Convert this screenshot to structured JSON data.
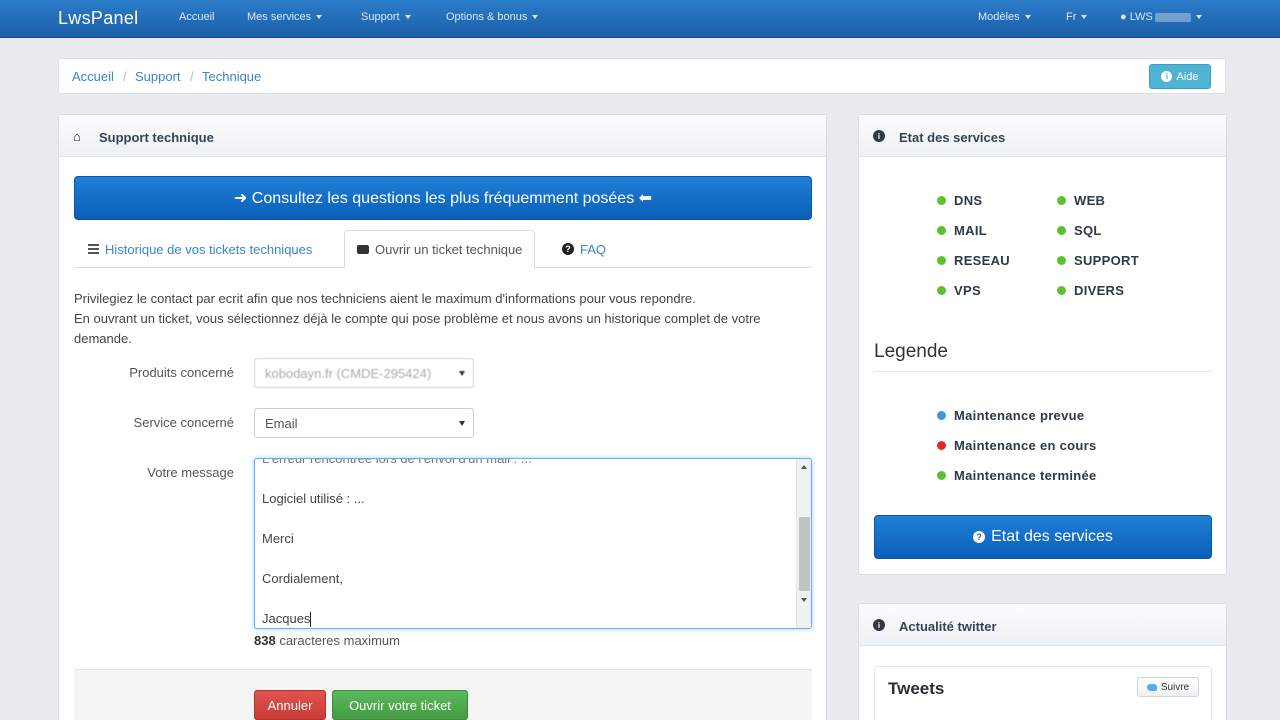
{
  "navbar": {
    "brand": "LwsPanel",
    "items": [
      "Accueil",
      "Mes services",
      "Support",
      "Options & bonus"
    ],
    "right": {
      "models": "Modèles",
      "lang": "Fr",
      "user": "LWS"
    }
  },
  "breadcrumb": {
    "items": [
      "Accueil",
      "Support",
      "Technique"
    ],
    "help_label": "Aide"
  },
  "support_panel": {
    "title": "Support technique",
    "faq_button": "➜ Consultez les questions les plus fréquemment posées ⬅",
    "tabs": [
      "Historique de vos tickets techniques",
      "Ouvrir un ticket technique",
      "FAQ"
    ],
    "intro_line1": "Privilegiez le contact par ecrit afin que nos techniciens aient le maximum d'informations pour vous repondre.",
    "intro_line2": "En ouvrant un ticket, vous sélectionnez déjà le compte qui pose problème et nous avons un historique complet de votre demande.",
    "fields": {
      "product_label": "Produits concerné",
      "product_value": "kobodayn.fr (CMDE-295424)",
      "service_label": "Service concerné",
      "service_value": "Email",
      "message_label": "Votre message"
    },
    "message_lines": {
      "cut": "L'erreur rencontrée lors de l'envoi d'un mail : ...",
      "l1": "Logiciel utilisé : ...",
      "l2": "Merci",
      "l3": "Cordialement,",
      "l4": "Jacques"
    },
    "counter_value": "838",
    "counter_text": " caracteres maximum",
    "cancel_label": "Annuler",
    "submit_label": "Ouvrir votre ticket"
  },
  "status_panel": {
    "title": "Etat des services",
    "services_left": [
      "DNS",
      "MAIL",
      "RESEAU",
      "VPS"
    ],
    "services_right": [
      "WEB",
      "SQL",
      "SUPPORT",
      "DIVERS"
    ],
    "legend_title": "Legende",
    "legend": [
      "Maintenance prevue",
      "Maintenance en cours",
      "Maintenance terminée"
    ],
    "button": "Etat des services"
  },
  "twitter_panel": {
    "title": "Actualité twitter",
    "card_title": "Tweets",
    "follow_label": "Suivre"
  },
  "colors": {
    "ok": "#5cc12f",
    "planned": "#3a9ad9",
    "ongoing": "#e02828",
    "done": "#5cc12f",
    "primary": "#1466c0"
  }
}
